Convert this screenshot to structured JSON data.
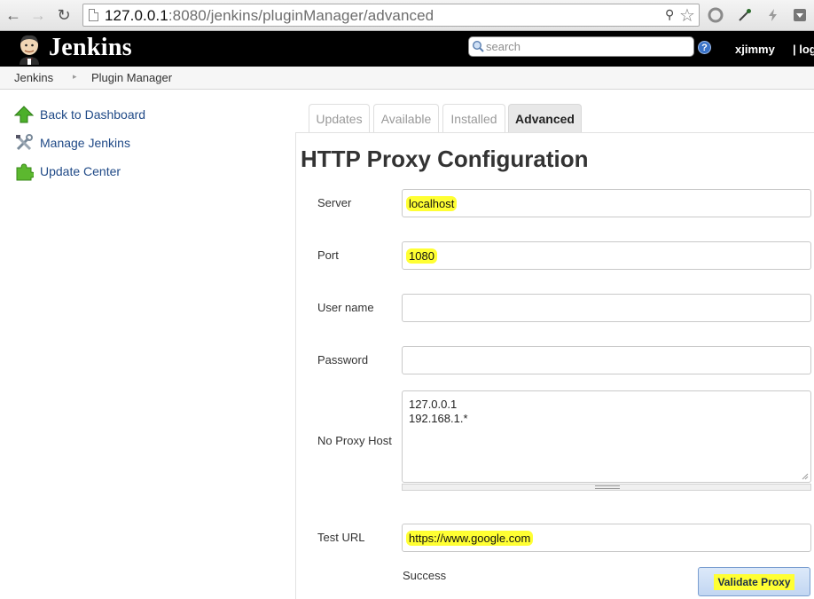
{
  "browser": {
    "url_host": "127.0.0.1",
    "url_path": ":8080/jenkins/pluginManager/advanced",
    "icons": [
      "back-arrow-icon",
      "forward-arrow-icon",
      "reload-icon",
      "page-icon",
      "key-icon",
      "star-icon",
      "circle-icon",
      "eyedropper-icon",
      "bolt-icon",
      "menu-icon"
    ]
  },
  "header": {
    "brand": "Jenkins",
    "search_placeholder": "search",
    "help": "?",
    "user": "xjimmy",
    "logout": "| log"
  },
  "breadcrumbs": [
    "Jenkins",
    "Plugin Manager"
  ],
  "sidebar": {
    "items": [
      {
        "label": "Back to Dashboard",
        "icon": "up-arrow-icon"
      },
      {
        "label": "Manage Jenkins",
        "icon": "tools-icon"
      },
      {
        "label": "Update Center",
        "icon": "puzzle-icon"
      }
    ]
  },
  "tabs": [
    {
      "label": "Updates",
      "active": false
    },
    {
      "label": "Available",
      "active": false
    },
    {
      "label": "Installed",
      "active": false
    },
    {
      "label": "Advanced",
      "active": true
    }
  ],
  "proxy": {
    "title": "HTTP Proxy Configuration",
    "server_label": "Server",
    "server_value": "localhost",
    "port_label": "Port",
    "port_value": "1080",
    "username_label": "User name",
    "username_value": "",
    "password_label": "Password",
    "password_value": "",
    "noproxy_label": "No Proxy Host",
    "noproxy_value": "127.0.0.1\n192.168.1.*",
    "testurl_label": "Test URL",
    "testurl_value": "https://www.google.com",
    "status": "Success",
    "validate_label": "Validate Proxy"
  },
  "colors": {
    "header_bg": "#000000",
    "link": "#204a87",
    "highlight": "#ffff33"
  }
}
